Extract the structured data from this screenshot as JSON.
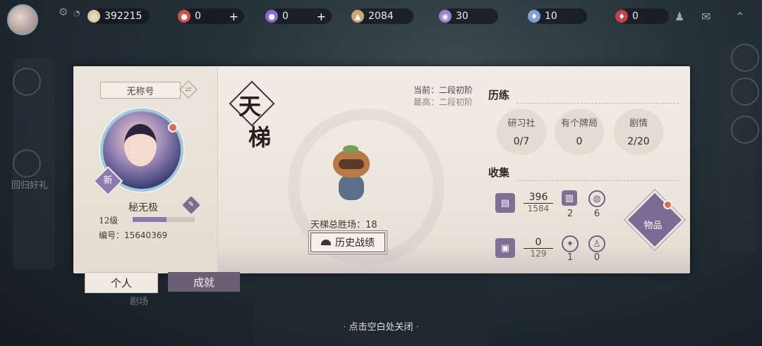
{
  "resources": [
    {
      "icon": "coin-icon",
      "value": "392215",
      "plus": false,
      "color": "#d9c8a4"
    },
    {
      "icon": "red-magatama-icon",
      "value": "0",
      "plus": true,
      "color": "#d0504a"
    },
    {
      "icon": "purple-magatama-icon",
      "value": "0",
      "plus": true,
      "color": "#8a6bd0"
    },
    {
      "icon": "stamina-icon",
      "value": "2084",
      "plus": false,
      "color": "#c9a874"
    },
    {
      "icon": "jade-icon",
      "value": "30",
      "plus": false,
      "color": "#9a86c8"
    },
    {
      "icon": "blue-ticket-icon",
      "value": "10",
      "plus": false,
      "color": "#7fa1d0"
    },
    {
      "icon": "red-ticket-icon",
      "value": "0",
      "plus": false,
      "color": "#c84048"
    }
  ],
  "profile": {
    "title_plate": "无称号",
    "badge_new": "新",
    "name": "秘无极",
    "level": "12级",
    "level_progress": 0.55,
    "uid_label": "编号：",
    "uid": "15640369"
  },
  "ladder": {
    "logo_1": "天",
    "logo_2": "梯",
    "current": "当前：二段初阶",
    "highest": "最高：二段初阶",
    "wins_label": "天梯总胜场：",
    "wins": "18",
    "history_button": "历史战绩"
  },
  "training": {
    "title": "历练",
    "items": [
      {
        "label": "研习社",
        "value": "0/7"
      },
      {
        "label": "有个牌局",
        "value": "0"
      },
      {
        "label": "剧情",
        "value": "2/20"
      }
    ]
  },
  "collection": {
    "title": "收集",
    "cards": {
      "owned": "396",
      "total": "1584"
    },
    "deck_count": "2",
    "item3_count": "6",
    "skins": {
      "owned": "0",
      "total": "129"
    },
    "item5_count": "1",
    "item6_count": "0",
    "items_button": "物品"
  },
  "tabs": {
    "personal": "个人",
    "achievement": "成就"
  },
  "background": {
    "left_label": "回归好礼",
    "left_sub": "剧场"
  },
  "close_hint": "点击空白处关闭"
}
